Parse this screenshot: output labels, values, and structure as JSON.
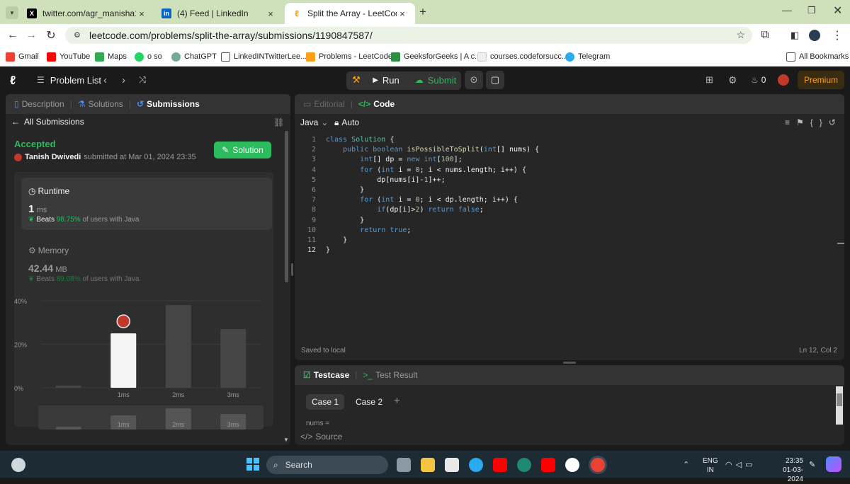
{
  "browser": {
    "tabs": [
      {
        "title": "twitter.com/agr_manisha10",
        "icon": "x-logo-icon",
        "active": false
      },
      {
        "title": "(4) Feed | LinkedIn",
        "icon": "linkedin-icon",
        "active": false
      },
      {
        "title": "Split the Array - LeetCode",
        "icon": "leetcode-icon",
        "active": true
      }
    ],
    "url": "leetcode.com/problems/split-the-array/submissions/1190847587/",
    "bookmarks": [
      "Gmail",
      "YouTube",
      "Maps",
      "o so",
      "ChatGPT",
      "LinkedINTwitterLee...",
      "Problems - LeetCode",
      "GeeksforGeeks | A c...",
      "courses.codeforsucc...",
      "Telegram"
    ],
    "all_bookmarks": "All Bookmarks"
  },
  "header": {
    "problem_list": "Problem List",
    "run": "Run",
    "submit": "Submit",
    "streak": "0",
    "premium": "Premium"
  },
  "left": {
    "tabs": [
      "Description",
      "Solutions",
      "Submissions"
    ],
    "back": "All Submissions",
    "status": "Accepted",
    "user": "Tanish Dwivedi",
    "submitted": "submitted at Mar 01, 2024 23:35",
    "solution_btn": "Solution",
    "runtime": {
      "label": "Runtime",
      "value": "1",
      "unit": "ms",
      "beats": "Beats",
      "pct": "98.75%",
      "suffix": "of users with Java"
    },
    "memory": {
      "label": "Memory",
      "value": "42.44",
      "unit": "MB",
      "beats": "Beats",
      "pct": "89.08%",
      "suffix": "of users with Java"
    },
    "chart_data": {
      "type": "bar",
      "y_ticks": [
        "40%",
        "20%",
        "0%"
      ],
      "ylim": [
        0,
        40
      ],
      "categories": [
        "",
        "1ms",
        "2ms",
        "3ms"
      ],
      "values": [
        1,
        25,
        38,
        27
      ],
      "highlight_index": 1,
      "mini_labels": [
        "1ms",
        "2ms",
        "3ms"
      ]
    }
  },
  "right": {
    "tabs": [
      "Editorial",
      "Code"
    ],
    "lang": "Java",
    "mode": "Auto",
    "code": [
      "class Solution {",
      "    public boolean isPossibleToSplit(int[] nums) {",
      "        int[] dp = new int[100];",
      "        for (int i = 0; i < nums.length; i++) {",
      "            dp[nums[i]-1]++;",
      "        }",
      "        for (int i = 0; i < dp.length; i++) {",
      "            if(dp[i]>2) return false;",
      "        }",
      "        return true;",
      "    }",
      "}"
    ],
    "saved": "Saved to local",
    "cursor": "Ln 12, Col 2",
    "bottom_tabs": [
      "Testcase",
      "Test Result"
    ],
    "cases": [
      "Case 1",
      "Case 2"
    ],
    "nums_label": "nums =",
    "source": "Source"
  },
  "taskbar": {
    "search": "Search",
    "lang": "ENG",
    "region": "IN",
    "time": "23:35",
    "date": "01-03-2024"
  }
}
